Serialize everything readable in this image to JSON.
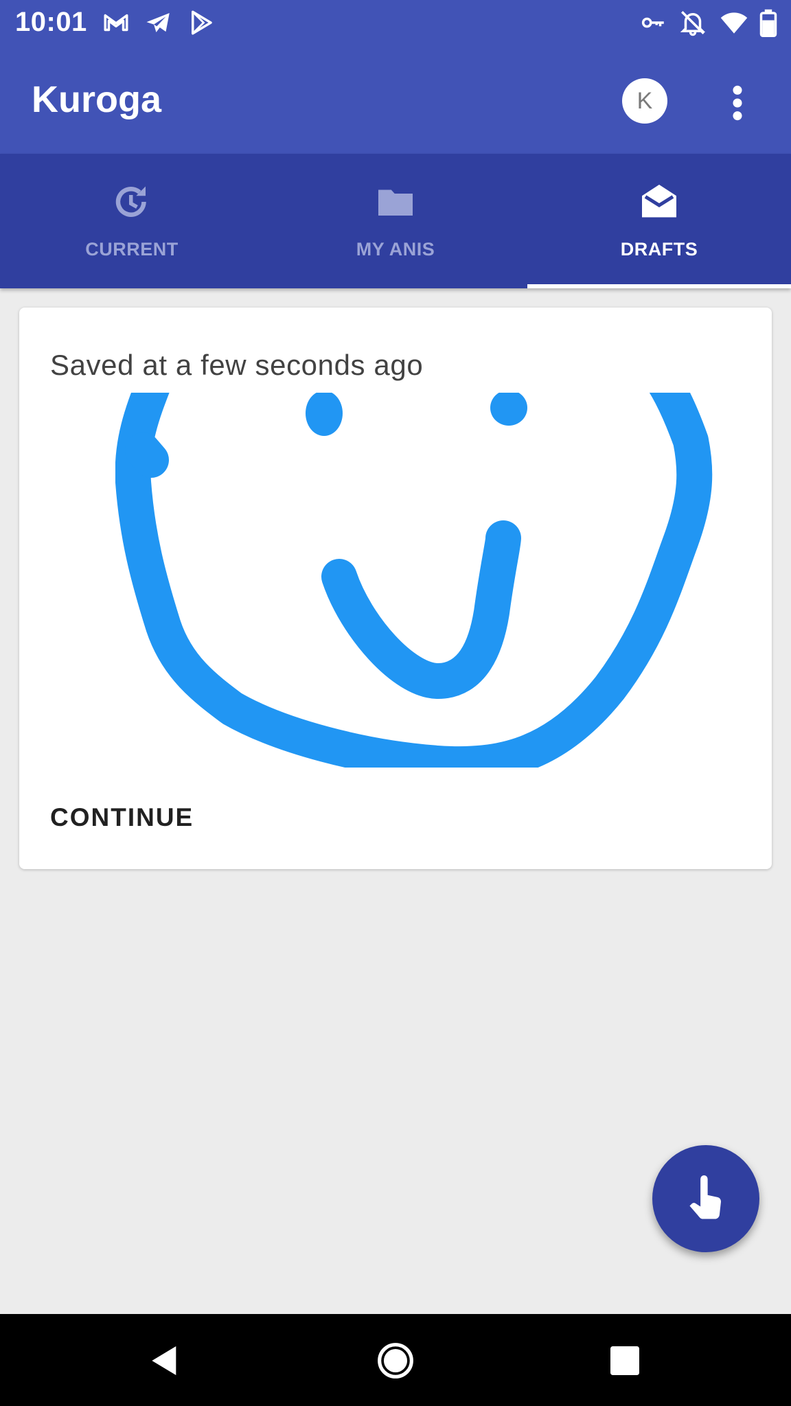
{
  "status_bar": {
    "time": "10:01",
    "left_icons": [
      "gmail-icon",
      "telegram-icon",
      "play-store-icon"
    ],
    "right_icons": [
      "vpn-key-icon",
      "notifications-off-icon",
      "wifi-icon",
      "battery-icon"
    ]
  },
  "app_bar": {
    "title": "Kuroga",
    "avatar_letter": "K"
  },
  "tabs": [
    {
      "label": "CURRENT",
      "icon": "history-icon",
      "active": false
    },
    {
      "label": "MY ANIS",
      "icon": "folder-icon",
      "active": false
    },
    {
      "label": "DRAFTS",
      "icon": "drafts-icon",
      "active": true
    }
  ],
  "draft": {
    "saved_text": "Saved at a few seconds ago",
    "continue_label": "CONTINUE"
  },
  "fab": {
    "icon": "touch-icon"
  },
  "nav_bar": {
    "buttons": [
      "back-icon",
      "home-icon",
      "recents-icon"
    ]
  },
  "colors": {
    "primary": "#4153b6",
    "primary_dark": "#303f9f",
    "stroke": "#2196f3",
    "background": "#ececec"
  }
}
